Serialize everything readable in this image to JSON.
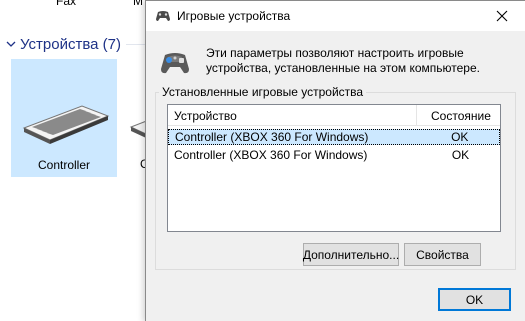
{
  "background": {
    "top_labels": [
      "Fax",
      "M"
    ],
    "group_title": "Устройства (7)",
    "tiles": [
      {
        "label": "Controller",
        "selected": true
      },
      {
        "label": "C",
        "selected": false
      }
    ]
  },
  "dialog": {
    "title": "Игровые устройства",
    "intro": "Эти параметры позволяют настроить игровые устройства, установленные на этом компьютере.",
    "group_label": "Установленные игровые устройства",
    "columns": {
      "device": "Устройство",
      "state": "Состояние"
    },
    "rows": [
      {
        "device": "Controller (XBOX 360 For Windows)",
        "state": "OK",
        "selected": true
      },
      {
        "device": "Controller (XBOX 360 For Windows)",
        "state": "OK",
        "selected": false
      }
    ],
    "buttons": {
      "advanced": "Дополнительно...",
      "properties": "Свойства",
      "ok": "OK"
    }
  },
  "icons": {
    "titlebar": "gamepad-icon",
    "intro": "gamepad-icon",
    "close": "close-icon",
    "group_toggle": "chevron-down-icon",
    "tile": "keyboard-icon"
  },
  "colors": {
    "group_title": "#1e3287",
    "selection": "#cce8ff",
    "dialog_bg": "#f0f0f0",
    "default_button_border": "#0078d7"
  }
}
